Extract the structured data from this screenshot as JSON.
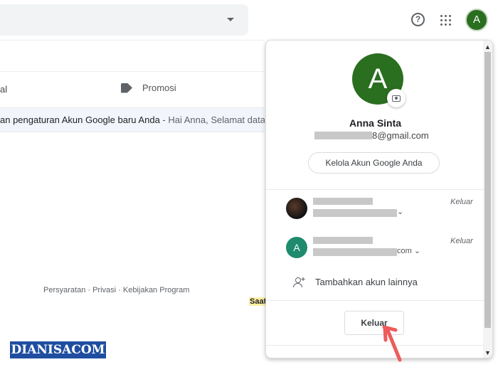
{
  "header": {
    "help_icon": "help-circle-icon",
    "apps_icon": "apps-grid-icon",
    "avatar_letter": "A",
    "avatar_color": "#2a6e1f"
  },
  "tabs": [
    {
      "label": "al"
    },
    {
      "label": "Promosi",
      "icon": "tag-icon"
    }
  ],
  "email_row": {
    "subject": "an pengaturan Akun Google baru Anda",
    "separator": " - ",
    "snippet": "Hai Anna, Selamat datang"
  },
  "footer": {
    "links": "Persyaratan · Privasi · Kebijakan Program",
    "highlight": "Saat"
  },
  "watermark": "DIANISACOM",
  "account_popup": {
    "avatar_letter": "A",
    "name": "Anna Sinta",
    "email_suffix": "8@gmail.com",
    "manage_button": "Kelola Akun Google Anda",
    "accounts": [
      {
        "avatar": "photo",
        "email_suffix": "",
        "signout": "Keluar"
      },
      {
        "avatar": "A",
        "avatar_color": "#1e8a6e",
        "email_suffix": "com",
        "signout": "Keluar"
      }
    ],
    "add_account": "Tambahkan akun lainnya",
    "signout_button": "Keluar"
  }
}
